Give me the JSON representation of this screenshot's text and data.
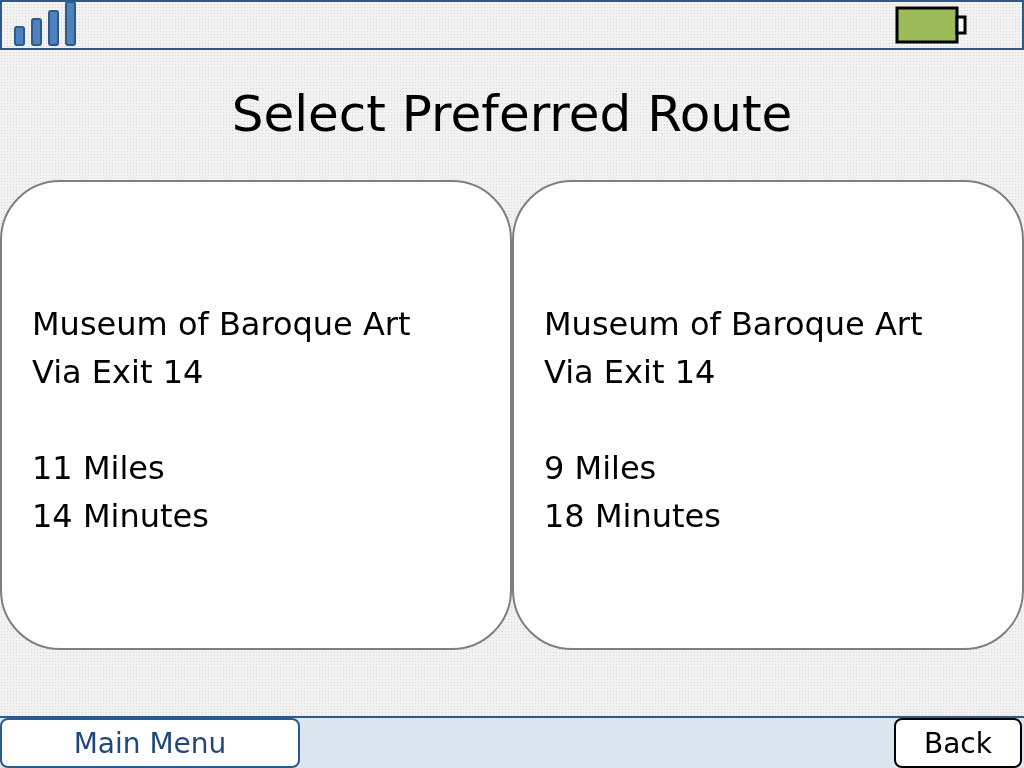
{
  "title": "Select Preferred Route",
  "routes": [
    {
      "destination": "Museum of Baroque Art",
      "via": "Via Exit 14",
      "distance": "11 Miles",
      "duration": "14 Minutes"
    },
    {
      "destination": "Museum of Baroque Art",
      "via": "Via Exit 14",
      "distance": "9 Miles",
      "duration": "18 Minutes"
    }
  ],
  "buttons": [
    {
      "label": "Main Menu",
      "kind": "menu"
    },
    {
      "label": "Back",
      "kind": "back"
    }
  ]
}
